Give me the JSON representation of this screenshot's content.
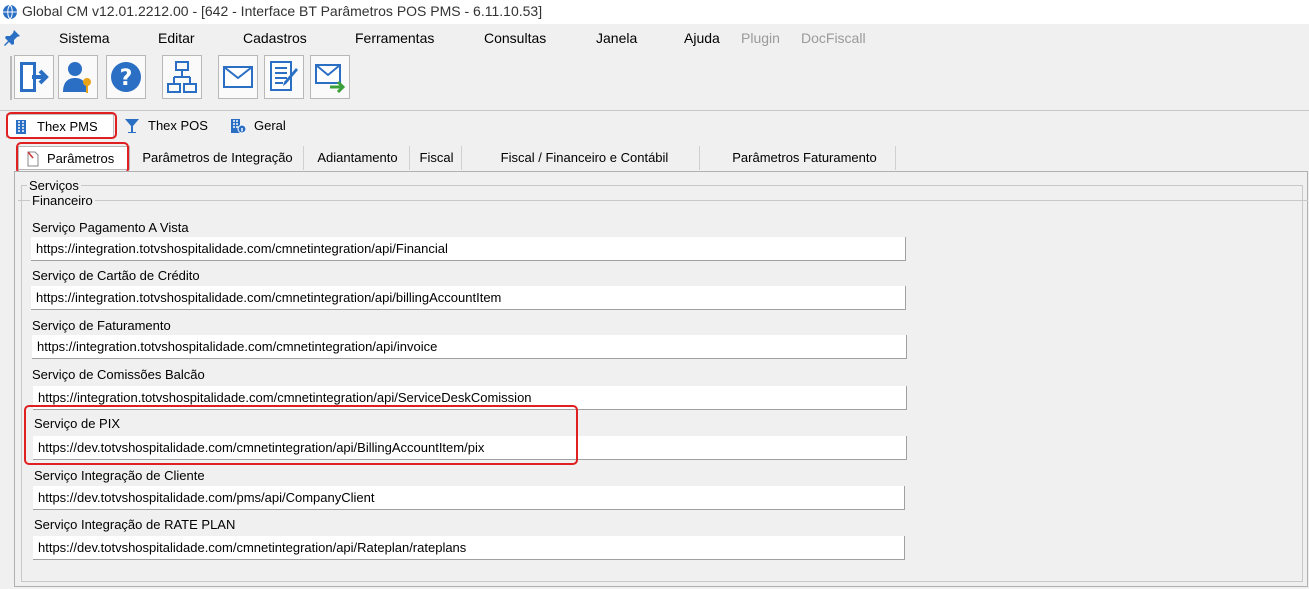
{
  "window": {
    "title": "Global CM v12.01.2212.00 - [642 - Interface BT Parâmetros POS PMS - 6.11.10.53]"
  },
  "menu": {
    "items": [
      "Sistema",
      "Editar",
      "Cadastros",
      "Ferramentas",
      "Consultas",
      "Janela",
      "Ajuda"
    ],
    "disabled": [
      "Plugin",
      "DocFiscall"
    ]
  },
  "toolbar": {
    "buttons": [
      "exit-icon",
      "user-key-icon",
      "help-icon",
      "network-icon",
      "email-icon",
      "document-edit-icon",
      "email-send-icon"
    ]
  },
  "main_tabs": [
    {
      "label": "Thex PMS",
      "icon": "building-icon",
      "active": true
    },
    {
      "label": "Thex POS",
      "icon": "glass-icon",
      "active": false
    },
    {
      "label": "Geral",
      "icon": "building-info-icon",
      "active": false
    }
  ],
  "sub_tabs": [
    {
      "label": "Parâmetros",
      "active": true
    },
    {
      "label": "Parâmetros de Integração",
      "active": false
    },
    {
      "label": "Adiantamento",
      "active": false
    },
    {
      "label": "Fiscal",
      "active": false
    },
    {
      "label": "Fiscal / Financeiro e Contábil",
      "active": false
    },
    {
      "label": "Parâmetros Faturamento",
      "active": false
    }
  ],
  "groups": {
    "servicos": "Serviços",
    "financeiro": "Financeiro"
  },
  "fields": [
    {
      "label": "Serviço Pagamento A Vista",
      "value": "https://integration.totvshospitalidade.com/cmnetintegration/api/Financial"
    },
    {
      "label": "Serviço de Cartão de Crédito",
      "value": "https://integration.totvshospitalidade.com/cmnetintegration/api/billingAccountItem"
    },
    {
      "label": "Serviço de Faturamento",
      "value": "https://integration.totvshospitalidade.com/cmnetintegration/api/invoice"
    },
    {
      "label": "Serviço de Comissões Balcão",
      "value": "https://integration.totvshospitalidade.com/cmnetintegration/api/ServiceDeskComission"
    },
    {
      "label": "Serviço de PIX",
      "value": "https://dev.totvshospitalidade.com/cmnetintegration/api/BillingAccountItem/pix"
    },
    {
      "label": "Serviço Integração de Cliente",
      "value": "https://dev.totvshospitalidade.com/pms/api/CompanyClient"
    },
    {
      "label": "Serviço Integração de RATE PLAN",
      "value": "https://dev.totvshospitalidade.com/cmnetintegration/api/Rateplan/rateplans"
    }
  ],
  "colors": {
    "highlight": "#e02020",
    "accent": "#2a6fc4"
  }
}
